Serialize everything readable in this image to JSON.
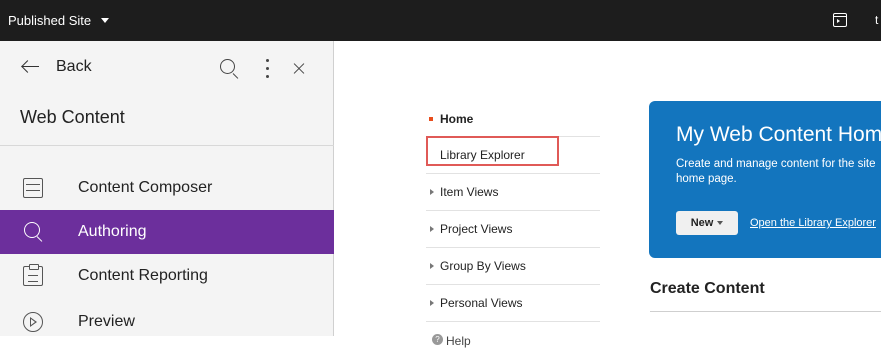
{
  "topbar": {
    "site_label": "Published Site",
    "right_icon": "sidebar-toggle-icon",
    "right_extra": "t"
  },
  "sidebar": {
    "back_label": "Back",
    "title": "Web Content",
    "items": [
      {
        "label": "Content Composer",
        "icon": "composer-icon",
        "active": false
      },
      {
        "label": "Authoring",
        "icon": "search-icon",
        "active": true
      },
      {
        "label": "Content Reporting",
        "icon": "clipboard-icon",
        "active": false
      },
      {
        "label": "Preview",
        "icon": "play-circle-icon",
        "active": false
      }
    ],
    "active_color": "#6c2f9c"
  },
  "library_nav": {
    "items": [
      {
        "label": "Home"
      },
      {
        "label": "Library Explorer"
      },
      {
        "label": "Item Views"
      },
      {
        "label": "Project Views"
      },
      {
        "label": "Group By Views"
      },
      {
        "label": "Personal Views"
      },
      {
        "label": "Help"
      }
    ]
  },
  "hero": {
    "title": "My Web Content Home",
    "description": "Create and manage content for the site home page.",
    "new_button": "New",
    "link": "Open the Library Explorer",
    "color": "#1375be"
  },
  "create": {
    "title": "Create Content"
  }
}
